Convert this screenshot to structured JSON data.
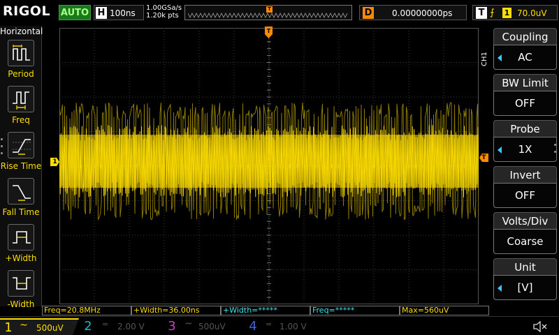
{
  "top_bar": {
    "logo": "RIGOL",
    "run_status": "AUTO",
    "horizontal_letter": "H",
    "timebase": "100ns",
    "sample_rate": "1.00GSa/s",
    "memory_depth": "1.20k pts",
    "trigger_position_marker": "T",
    "delay_letter": "D",
    "delay_value": "0.00000000ps",
    "trigger_letter": "T",
    "trigger_edge_icon": "rising-edge-icon",
    "trigger_source": "1",
    "trigger_level": "70.0uV"
  },
  "left_panel": {
    "title": "Horizontal",
    "items": [
      {
        "label": "Period",
        "icon": "period-icon"
      },
      {
        "label": "Freq",
        "icon": "frequency-icon"
      },
      {
        "label": "Rise Time",
        "icon": "rise-time-icon"
      },
      {
        "label": "Fall Time",
        "icon": "fall-time-icon"
      },
      {
        "label": "+Width",
        "icon": "positive-width-icon"
      },
      {
        "label": "-Width",
        "icon": "negative-width-icon"
      }
    ]
  },
  "screen": {
    "trigger_marker": "T",
    "ch1_ground_marker": "1",
    "trigger_level_marker": "T"
  },
  "right_menu": {
    "channel_tag": "CH1",
    "items": [
      {
        "title": "Coupling",
        "value": "AC",
        "has_arrow": true
      },
      {
        "title": "BW Limit",
        "value": "OFF",
        "has_arrow": false
      },
      {
        "title": "Probe",
        "value": "1X",
        "has_arrow": true
      },
      {
        "title": "Invert",
        "value": "OFF",
        "has_arrow": false
      },
      {
        "title": "Volts/Div",
        "value": "Coarse",
        "has_arrow": false
      },
      {
        "title": "Unit",
        "value": "[V]",
        "has_arrow": true
      }
    ]
  },
  "measurements": [
    {
      "text": "Freq=20.8MHz",
      "color": "#ffde00"
    },
    {
      "text": "+Width=36.00ns",
      "color": "#ffde00"
    },
    {
      "text": "+Width=*****",
      "color": "#3ee6f0"
    },
    {
      "text": "Freq=*****",
      "color": "#3ee6f0"
    },
    {
      "text": "Max=560uV",
      "color": "#ffde00"
    }
  ],
  "channels": [
    {
      "number": "1",
      "coupling_symbol": "~",
      "scale": "500uV",
      "color": "#ffde00",
      "active": true
    },
    {
      "number": "2",
      "coupling_symbol": "=",
      "scale": "2.00 V",
      "color": "#18b6c8",
      "active": false
    },
    {
      "number": "3",
      "coupling_symbol": "~",
      "scale": "500uV",
      "color": "#c83ec8",
      "active": false
    },
    {
      "number": "4",
      "coupling_symbol": "=",
      "scale": "1.00 V",
      "color": "#3e62d8",
      "active": false
    }
  ],
  "colors": {
    "ch1": "#ffde00",
    "trigger": "#ff8a00",
    "menu_arrow": "#3ec6ff",
    "run_badge": "#1a7a1a"
  },
  "speaker_icon": "speaker-muted-icon"
}
